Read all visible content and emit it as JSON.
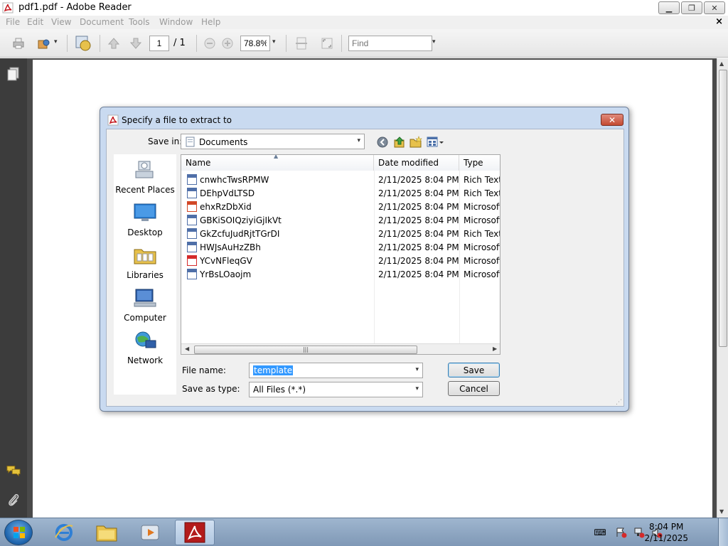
{
  "window": {
    "title": "pdf1.pdf - Adobe Reader",
    "min_glyph": "▁",
    "max_glyph": "❐",
    "close_glyph": "✕"
  },
  "menubar": {
    "items": [
      "File",
      "Edit",
      "View",
      "Document",
      "Tools",
      "Window",
      "Help"
    ],
    "close_glyph": "×"
  },
  "toolbar": {
    "page_current": "1",
    "page_total": "/ 1",
    "zoom": "78.8%",
    "find_placeholder": "Find",
    "dropdown_glyph": "▾"
  },
  "dialog": {
    "title": "Specify a file to extract to",
    "close_glyph": "✕",
    "save_in_label": "Save in:",
    "save_in_value": "Documents",
    "places": [
      {
        "label": "Recent Places"
      },
      {
        "label": "Desktop"
      },
      {
        "label": "Libraries"
      },
      {
        "label": "Computer"
      },
      {
        "label": "Network"
      }
    ],
    "columns": {
      "name": "Name",
      "date": "Date modified",
      "type": "Type"
    },
    "files": [
      {
        "name": "cnwhcTwsRPMW",
        "date": "2/11/2025 8:04 PM",
        "type": "Rich Text",
        "icon": "word-doc-icon"
      },
      {
        "name": "DEhpVdLTSD",
        "date": "2/11/2025 8:04 PM",
        "type": "Rich Text",
        "icon": "word-doc-icon"
      },
      {
        "name": "ehxRzDbXid",
        "date": "2/11/2025 8:04 PM",
        "type": "Microsoft",
        "icon": "powerpoint-icon"
      },
      {
        "name": "GBKiSOIQziyiGjIkVt",
        "date": "2/11/2025 8:04 PM",
        "type": "Microsoft",
        "icon": "word-doc-icon"
      },
      {
        "name": "GkZcfuJudRjtTGrDI",
        "date": "2/11/2025 8:04 PM",
        "type": "Rich Text",
        "icon": "word-doc-icon"
      },
      {
        "name": "HWJsAuHzZBh",
        "date": "2/11/2025 8:04 PM",
        "type": "Microsoft",
        "icon": "word-doc-icon"
      },
      {
        "name": "YCvNFleqGV",
        "date": "2/11/2025 8:04 PM",
        "type": "Microsoft",
        "icon": "excel-icon"
      },
      {
        "name": "YrBsLOaojm",
        "date": "2/11/2025 8:04 PM",
        "type": "Microsoft",
        "icon": "word-doc-icon"
      }
    ],
    "file_name_label": "File name:",
    "file_name_value": "template",
    "save_type_label": "Save as type:",
    "save_type_value": "All Files (*.*)",
    "save_button": "Save",
    "cancel_button": "Cancel",
    "dropdown_glyph": "▾"
  },
  "taskbar": {
    "time": "8:04 PM",
    "date": "2/11/2025"
  },
  "colors": {
    "dialog_frame": "#c9daf0",
    "selection": "#3399ff",
    "close_red": "#c44a32",
    "dark_panel": "#3c3c3c"
  }
}
